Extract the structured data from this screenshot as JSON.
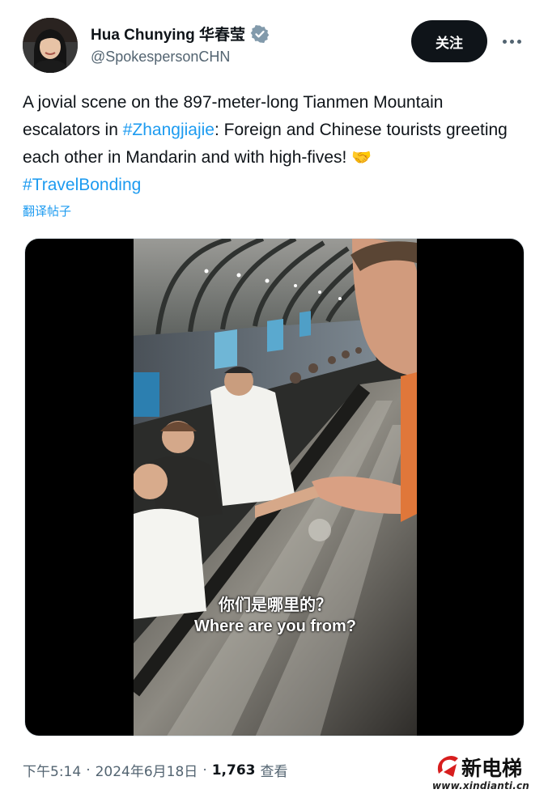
{
  "author": {
    "display_name": "Hua Chunying 华春莹",
    "handle": "@SpokespersonCHN",
    "verified": true,
    "avatar_icon": "avatar-photo"
  },
  "actions": {
    "follow_label": "关注",
    "more_icon": "more-horizontal-icon"
  },
  "tweet": {
    "text_1": "A jovial scene on the 897-meter-long Tianmen Mountain escalators in ",
    "hashtag_1": "#Zhangjiajie",
    "text_2": ": Foreign and Chinese tourists greeting each other in Mandarin and with high-fives! ",
    "emoji": "🤝",
    "hashtag_2": "#TravelBonding",
    "translate_label": "翻译帖子"
  },
  "media": {
    "subtitle_cn": "你们是哪里的？",
    "subtitle_en": "Where are you from?"
  },
  "meta": {
    "time": "下午5:14",
    "separator_1": "·",
    "date": "2024年6月18日",
    "separator_2": "·",
    "view_count": "1,763",
    "views_label": "查看"
  },
  "watermark": {
    "title": "新电梯",
    "url": "www.xindianti.cn"
  },
  "colors": {
    "link": "#1d9bf0",
    "secondary_text": "#536471",
    "primary_text": "#0f1419",
    "verified_badge": "#829aab",
    "watermark_accent": "#d71e1e"
  }
}
